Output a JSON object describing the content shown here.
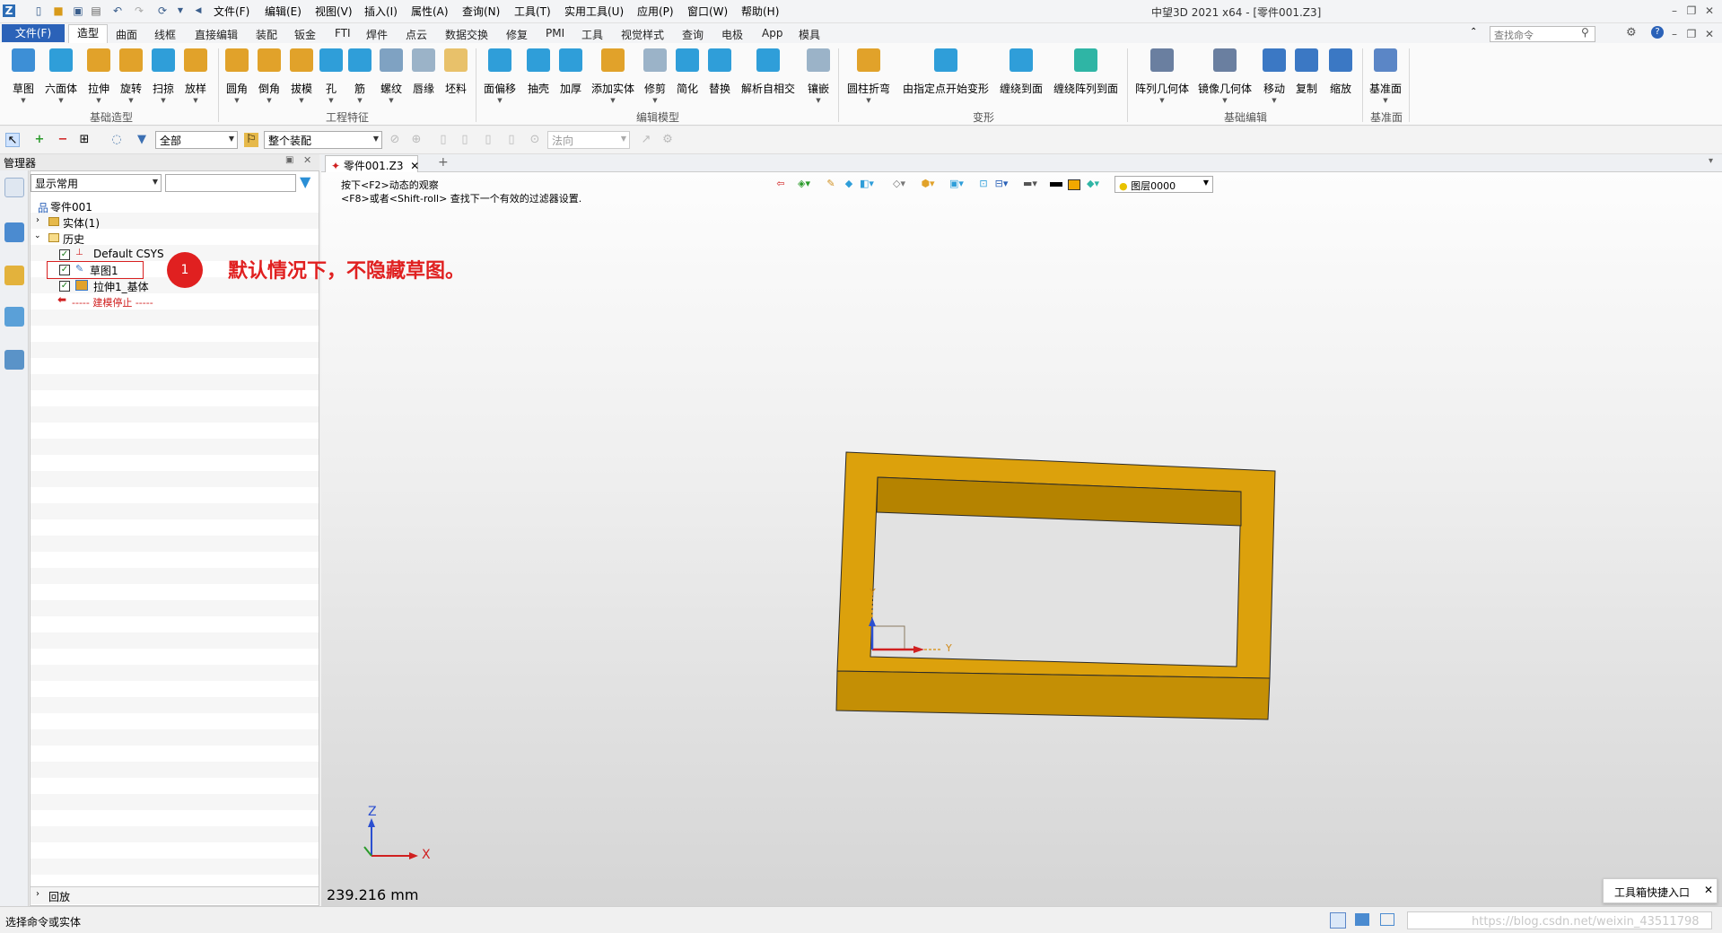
{
  "app": {
    "window_title": "中望3D 2021 x64 - [零件001.Z3]"
  },
  "menu": [
    "文件(F)",
    "编辑(E)",
    "视图(V)",
    "插入(I)",
    "属性(A)",
    "查询(N)",
    "工具(T)",
    "实用工具(U)",
    "应用(P)",
    "窗口(W)",
    "帮助(H)"
  ],
  "tabs": {
    "file": "文件(F)",
    "active": "造型",
    "others": [
      "曲面",
      "线框",
      "直接编辑",
      "装配",
      "钣金",
      "FTI",
      "焊件",
      "点云",
      "数据交换",
      "修复",
      "PMI",
      "工具",
      "视觉样式",
      "查询",
      "电极",
      "App",
      "模具"
    ]
  },
  "search": {
    "placeholder": "查找命令"
  },
  "ribbon": {
    "groups": [
      "基础造型",
      "工程特征",
      "编辑模型",
      "变形",
      "基础编辑",
      "基准面"
    ],
    "buttons": [
      "草图",
      "六面体",
      "拉伸",
      "旋转",
      "扫掠",
      "放样",
      "圆角",
      "倒角",
      "拔模",
      "孔",
      "筋",
      "螺纹",
      "唇缘",
      "坯料",
      "面偏移",
      "抽壳",
      "加厚",
      "添加实体",
      "修剪",
      "简化",
      "替换",
      "解析自相交",
      "镶嵌",
      "圆柱折弯",
      "由指定点开始变形",
      "缠绕到面",
      "缠绕阵列到面",
      "阵列几何体",
      "镜像几何体",
      "移动",
      "复制",
      "缩放",
      "基准面"
    ]
  },
  "toolbar2": {
    "filter": "全部",
    "scope": "整个装配",
    "direction": "法向"
  },
  "manager": {
    "title": "管理器",
    "display_filter": "显示常用",
    "tree": {
      "root": "零件001",
      "solid": "实体(1)",
      "history": "历史",
      "csys": "Default CSYS",
      "sketch": "草图1",
      "extrude": "拉伸1_基体",
      "stop": "----- 建模停止 -----"
    },
    "playback": "回放"
  },
  "annotation": {
    "number": "1",
    "text": "默认情况下，不隐藏草图。"
  },
  "viewport": {
    "doc_tab": "零件001.Z3",
    "hint1": "按下<F2>动态的观察",
    "hint2": "<F8>或者<Shift-roll> 查找下一个有效的过滤器设置.",
    "layer": "图层0000",
    "measure": "239.216 mm",
    "axis_x": "X",
    "axis_y": "Y",
    "axis_z": "Z"
  },
  "toolbox": {
    "label": "工具箱快捷入口"
  },
  "status": {
    "message": "选择命令或实体",
    "watermark": "https://blog.csdn.net/weixin_43511798"
  },
  "colors": {
    "accent": "#2b62b8",
    "part": "#dca10c",
    "part_dark": "#b58300",
    "annotation": "#e02020"
  }
}
